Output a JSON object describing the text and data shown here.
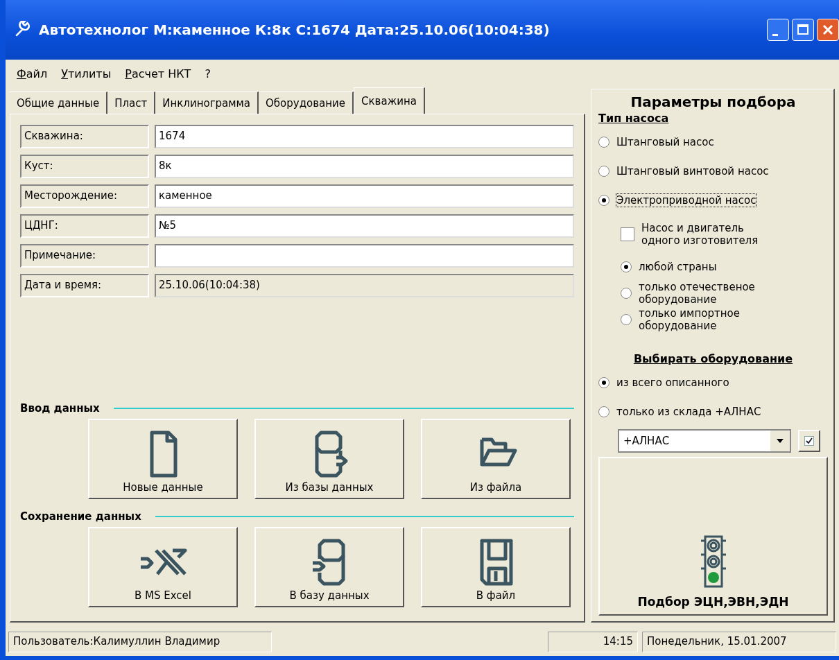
{
  "window": {
    "title": "Автотехнолог  М:каменное  К:8к  С:1674  Дата:25.10.06(10:04:38)"
  },
  "menu": [
    {
      "label": "Файл"
    },
    {
      "label": "Утилиты"
    },
    {
      "label": "Расчет НКТ"
    },
    {
      "label": "?"
    }
  ],
  "tabs": [
    {
      "label": "Общие данные",
      "selected": false
    },
    {
      "label": "Пласт",
      "selected": false
    },
    {
      "label": "Инклинограмма",
      "selected": false
    },
    {
      "label": "Оборудование",
      "selected": false
    },
    {
      "label": "Скважина",
      "selected": true
    }
  ],
  "fields": [
    {
      "label": "Скважина:",
      "value": "1674",
      "disabled": false
    },
    {
      "label": "Куст:",
      "value": "8к",
      "disabled": false
    },
    {
      "label": "Месторождение:",
      "value": "каменное",
      "disabled": false
    },
    {
      "label": "ЦДНГ:",
      "value": "№5",
      "disabled": false
    },
    {
      "label": "Примечание:",
      "disabled": false
    },
    {
      "label": "Дата и время:",
      "value": "25.10.06(10:04:38)",
      "disabled": true
    }
  ],
  "sections": [
    {
      "title": "Ввод данных",
      "buttons": [
        {
          "label": "Новые данные",
          "kind": "new"
        },
        {
          "label": "Из базы данных",
          "kind": "dbin"
        },
        {
          "label": "Из файла",
          "kind": "open"
        }
      ]
    },
    {
      "title": "Сохранение данных",
      "buttons": [
        {
          "label": "В MS Excel",
          "kind": "excel"
        },
        {
          "label": "В базу данных",
          "kind": "dbout"
        },
        {
          "label": "В файл",
          "kind": "save"
        }
      ]
    }
  ],
  "params": {
    "title": "Параметры подбора",
    "pump_type_title": "Тип насоса",
    "pump_types": [
      {
        "label": "Штанговый насос",
        "selected": false,
        "focused": false
      },
      {
        "label": "Штанговый винтовой насос",
        "selected": false,
        "focused": false
      },
      {
        "label": "Электроприводной насос",
        "selected": true,
        "focused": true
      }
    ],
    "same_maker": {
      "label": "Насос и двигатель одного изготовителя",
      "checked": false
    },
    "origins": [
      {
        "label": "любой страны",
        "selected": true
      },
      {
        "label": "только отечественое оборудование",
        "selected": false
      },
      {
        "label": "только импортное оборудование",
        "selected": false
      }
    ],
    "source_title": "Выбирать оборудование",
    "sources": [
      {
        "label": "из всего описанного",
        "selected": true
      },
      {
        "label": "только из склада +АЛНАС",
        "selected": false
      }
    ],
    "warehouse": {
      "value": "+АЛНАС"
    },
    "run_button": {
      "label": "Подбор ЭЦН,ЭВН,ЭДН"
    }
  },
  "status_bar": {
    "user": "Пользователь:Калимуллин Владимир",
    "time": "14:15",
    "date": "Понедельник, 15.01.2007"
  }
}
